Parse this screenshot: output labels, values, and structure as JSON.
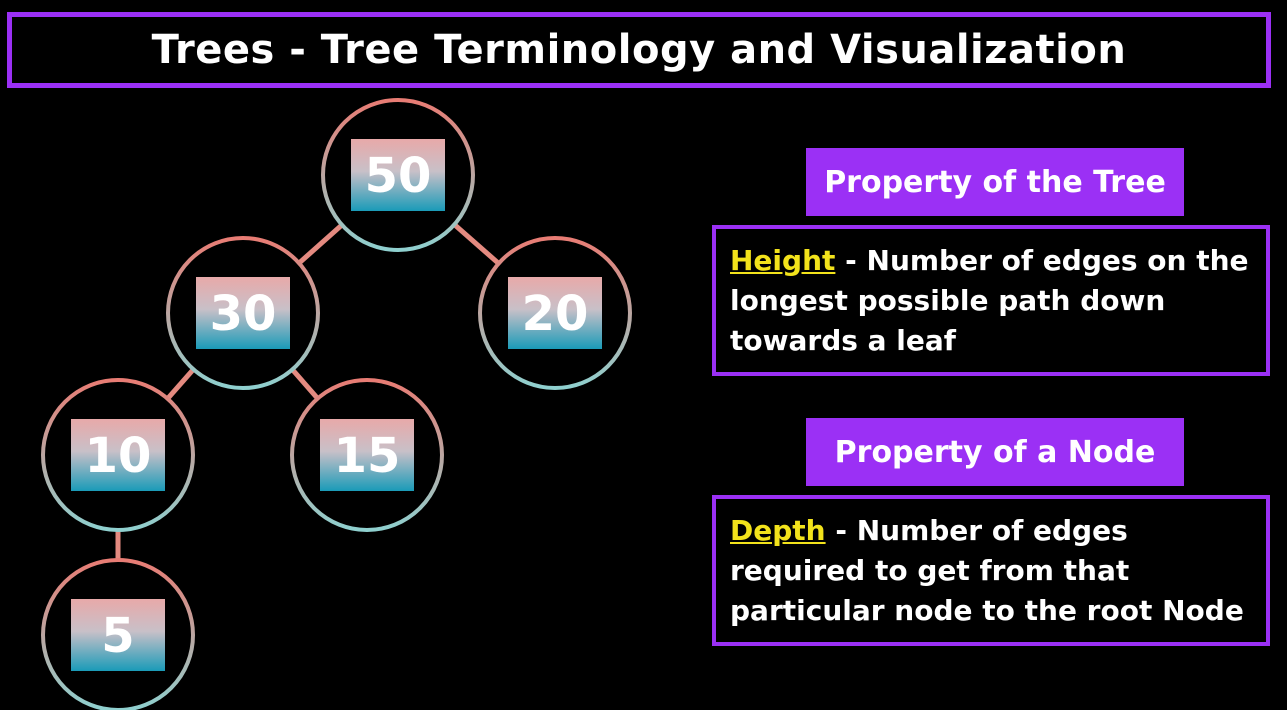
{
  "title": "Trees - Tree Terminology and Visualization",
  "colors": {
    "accent": "#9b30f5",
    "term": "#f2e21b",
    "edge": "#e48a80",
    "node_top": "#e8a9a9",
    "node_bottom": "#1a9bb8"
  },
  "tree": {
    "nodes": [
      {
        "id": "n50",
        "label": "50"
      },
      {
        "id": "n30",
        "label": "30"
      },
      {
        "id": "n20",
        "label": "20"
      },
      {
        "id": "n10",
        "label": "10"
      },
      {
        "id": "n15",
        "label": "15"
      },
      {
        "id": "n5",
        "label": "5"
      }
    ],
    "edges": [
      [
        "n50",
        "n30"
      ],
      [
        "n50",
        "n20"
      ],
      [
        "n30",
        "n10"
      ],
      [
        "n30",
        "n15"
      ],
      [
        "n10",
        "n5"
      ]
    ]
  },
  "tree_property": {
    "header": "Property of the Tree",
    "term": "Height",
    "description": " - Number of edges on the longest possible path down towards a leaf"
  },
  "node_property": {
    "header": "Property of a Node",
    "term": "Depth",
    "description": " - Number of edges required to get from that particular node to the root Node"
  }
}
